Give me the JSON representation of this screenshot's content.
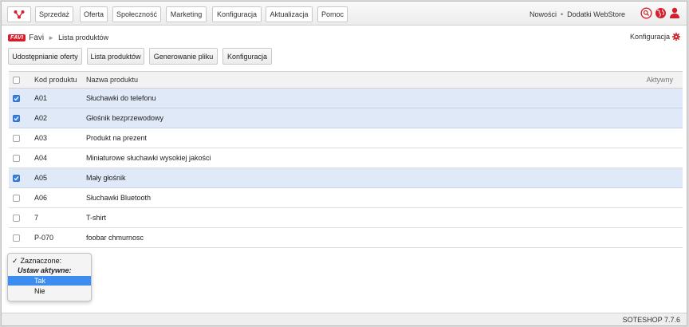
{
  "nav": {
    "items": [
      {
        "label": "Sprzedaż"
      },
      {
        "label": "Oferta"
      },
      {
        "label": "Społeczność"
      },
      {
        "label": "Marketing"
      },
      {
        "label": "Konfiguracja"
      },
      {
        "label": "Aktualizacja"
      },
      {
        "label": "Pomoc"
      }
    ],
    "news_label": "Nowości",
    "separator": "•",
    "addons_label": "Dodatki WebStore"
  },
  "breadcrumb": {
    "logo_text": "FAVI",
    "title": "Favi",
    "separator": "►",
    "current": "Lista produktów"
  },
  "config_link": "Konfiguracja",
  "tabs": [
    {
      "label": "Udostępnianie oferty"
    },
    {
      "label": "Lista produktów"
    },
    {
      "label": "Generowanie pliku"
    },
    {
      "label": "Konfiguracja"
    }
  ],
  "table": {
    "headers": {
      "code": "Kod produktu",
      "name": "Nazwa produktu",
      "active": "Aktywny"
    },
    "rows": [
      {
        "code": "A01",
        "name": "Słuchawki do telefonu",
        "checked": true
      },
      {
        "code": "A02",
        "name": "Głośnik bezprzewodowy",
        "checked": true
      },
      {
        "code": "A03",
        "name": "Produkt na prezent",
        "checked": false
      },
      {
        "code": "A04",
        "name": "Miniaturowe słuchawki wysokiej jakości",
        "checked": false
      },
      {
        "code": "A05",
        "name": "Mały głośnik",
        "checked": true
      },
      {
        "code": "A06",
        "name": "Słuchawki Bluetooth",
        "checked": false
      },
      {
        "code": "7",
        "name": "T-shirt",
        "checked": false
      },
      {
        "code": "P-070",
        "name": "foobar chmurnosc",
        "checked": false
      }
    ]
  },
  "dropdown": {
    "check_mark": "✓",
    "header": "Zaznaczone:",
    "group": "Ustaw aktywne:",
    "options": [
      "Tak",
      "Nie"
    ],
    "highlighted": "Tak"
  },
  "footer": {
    "version": "SOTESHOP 7.7.6"
  },
  "colors": {
    "brand_red": "#d81e2b",
    "selection_row": "#dfe9f7",
    "checkbox_on": "#3b82e0",
    "menu_highlight": "#3d8cf0"
  }
}
